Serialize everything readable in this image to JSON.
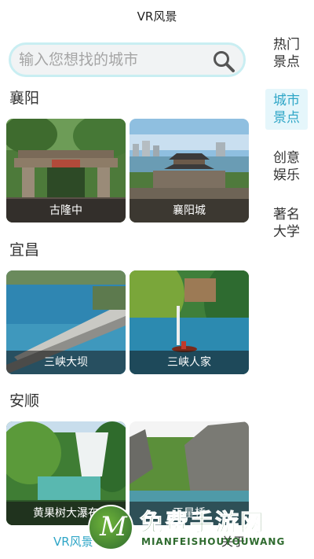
{
  "header": {
    "title": "VR风景"
  },
  "search": {
    "placeholder": "输入您想找的城市",
    "icon": "search-icon"
  },
  "sections": [
    {
      "title": "襄阳",
      "cards": [
        {
          "label": "古隆中"
        },
        {
          "label": "襄阳城"
        }
      ]
    },
    {
      "title": "宜昌",
      "cards": [
        {
          "label": "三峡大坝"
        },
        {
          "label": "三峡人家"
        }
      ]
    },
    {
      "title": "安顺",
      "cards": [
        {
          "label": "黄果树大瀑布"
        },
        {
          "label": "天星桥"
        }
      ]
    }
  ],
  "sidebar": {
    "items": [
      {
        "label_line1": "热门",
        "label_line2": "景点",
        "active": false
      },
      {
        "label_line1": "城市",
        "label_line2": "景点",
        "active": true
      },
      {
        "label_line1": "创意",
        "label_line2": "娱乐",
        "active": false
      },
      {
        "label_line1": "著名",
        "label_line2": "大学",
        "active": false
      }
    ]
  },
  "bottom_nav": {
    "tab1": "VR风景",
    "tab2": "关于"
  },
  "watermark": {
    "logo_letter": "M",
    "text_cn": "免费手游网",
    "text_en": "MIANFEISHOUYOUWANG"
  },
  "colors": {
    "accent": "#2fa6c7",
    "active_bg": "#e5f6fb",
    "caption_bg": "#1e1e1e"
  }
}
